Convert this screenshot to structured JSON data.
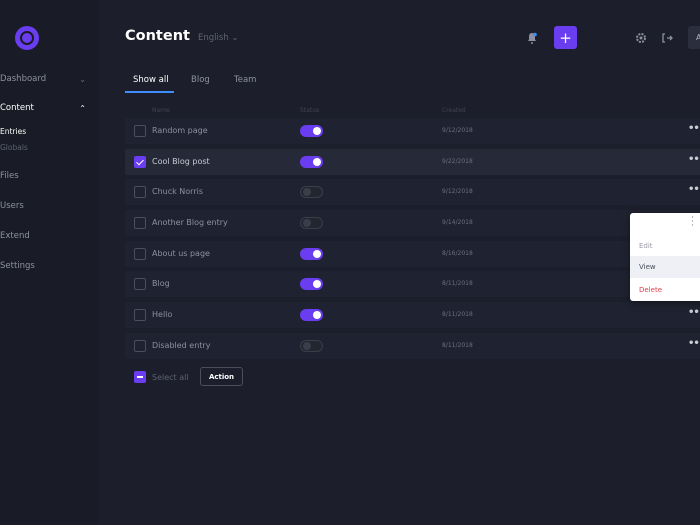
{
  "sidebar": {
    "items": [
      {
        "label": "Dashboard",
        "active": false
      },
      {
        "label": "Content",
        "active": true
      },
      {
        "label": "Files",
        "active": false
      },
      {
        "label": "Users",
        "active": false
      },
      {
        "label": "Extend",
        "active": false
      },
      {
        "label": "Settings",
        "active": false
      }
    ],
    "sub_items": [
      {
        "label": "Entries",
        "active": true
      },
      {
        "label": "Globals",
        "active": false
      }
    ]
  },
  "header": {
    "title": "Content",
    "language": "English",
    "avatar_initial": "A"
  },
  "tabs": [
    {
      "label": "Show all",
      "active": true
    },
    {
      "label": "Blog",
      "active": false
    },
    {
      "label": "Team",
      "active": false
    }
  ],
  "table": {
    "columns": [
      "Name",
      "Status",
      "Created"
    ],
    "rows": [
      {
        "name": "Random page",
        "checked": false,
        "status_on": true,
        "date": "9/12/2018"
      },
      {
        "name": "Cool Blog post",
        "checked": true,
        "status_on": true,
        "date": "9/22/2018"
      },
      {
        "name": "Chuck Norris",
        "checked": false,
        "status_on": false,
        "date": "9/12/2018"
      },
      {
        "name": "Another Blog entry",
        "checked": false,
        "status_on": false,
        "date": "9/14/2018"
      },
      {
        "name": "About us page",
        "checked": false,
        "status_on": true,
        "date": "8/16/2018"
      },
      {
        "name": "Blog",
        "checked": false,
        "status_on": true,
        "date": "8/11/2018"
      },
      {
        "name": "Hello",
        "checked": false,
        "status_on": true,
        "date": "8/11/2018"
      },
      {
        "name": "Disabled entry",
        "checked": false,
        "status_on": false,
        "date": "8/11/2018"
      }
    ]
  },
  "footer": {
    "select_all_label": "Select all",
    "action_label": "Action"
  },
  "context_menu": {
    "items": [
      "Edit",
      "View",
      "Delete"
    ]
  },
  "colors": {
    "accent": "#6a3df0",
    "tab_underline": "#3f8cff",
    "delete": "#e03d4d"
  }
}
